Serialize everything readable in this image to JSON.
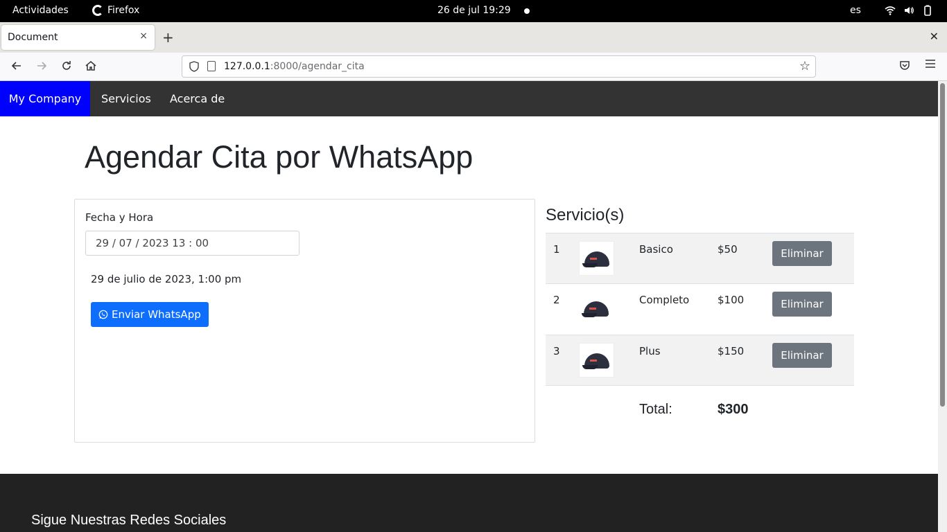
{
  "system_bar": {
    "activities": "Actividades",
    "app_name": "Firefox",
    "clock": "26 de jul  19:29",
    "language": "es"
  },
  "browser": {
    "tab_title": "Document",
    "new_tab": "+",
    "close_tab": "×",
    "close_window": "✕",
    "url_host": "127.0.0.1",
    "url_path": ":8000/agendar_cita"
  },
  "site_nav": {
    "brand": "My Company",
    "links": [
      "Servicios",
      "Acerca de"
    ],
    "brand_color": "#0000ff"
  },
  "page": {
    "title": "Agendar Cita por WhatsApp"
  },
  "form": {
    "label": "Fecha y Hora",
    "datetime_value": "29 / 07 / 2023   13 : 00",
    "formatted_date": "29 de julio de 2023, 1:00 pm",
    "whatsapp_button": "Enviar WhatsApp",
    "whatsapp_icon": "whatsapp-icon"
  },
  "services": {
    "title": "Servicio(s)",
    "rows": [
      {
        "num": "1",
        "name": "Basico",
        "price": "$50",
        "action": "Eliminar"
      },
      {
        "num": "2",
        "name": "Completo",
        "price": "$100",
        "action": "Eliminar"
      },
      {
        "num": "3",
        "name": "Plus",
        "price": "$150",
        "action": "Eliminar"
      }
    ],
    "total_label": "Total:",
    "total_value": "$300"
  },
  "footer": {
    "social_title": "Sigue Nuestras Redes Sociales"
  },
  "colors": {
    "primary_button": "#0d6efd",
    "secondary_button": "#6c757d",
    "navbar": "#333333",
    "footer": "#222222"
  }
}
